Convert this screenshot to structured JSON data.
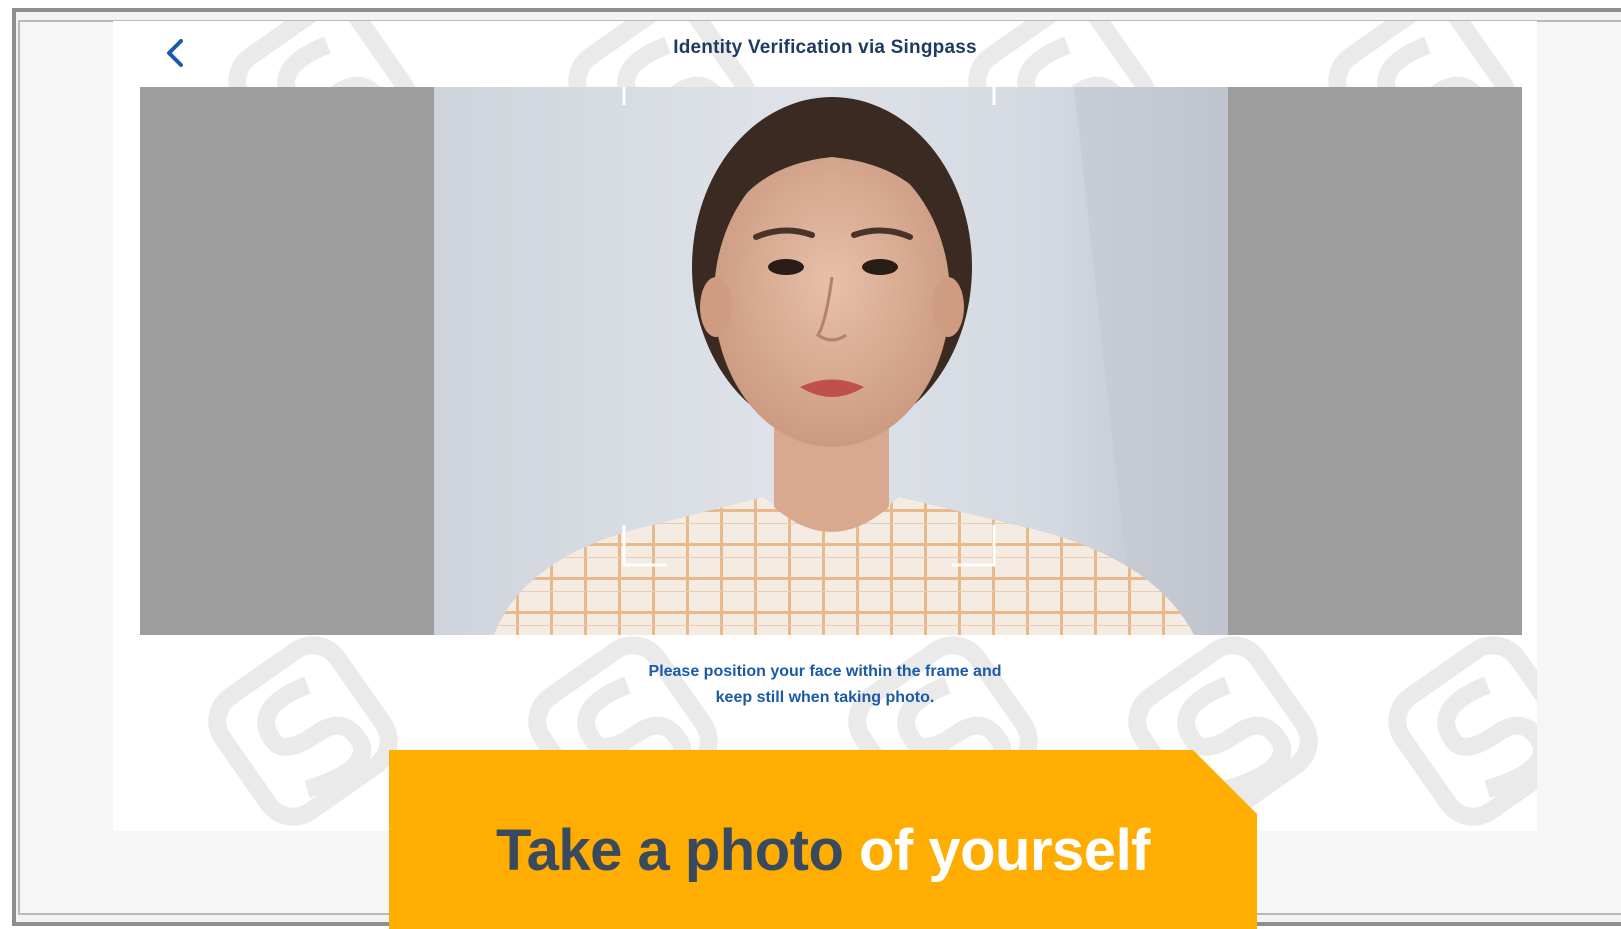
{
  "header": {
    "title": "Identity Verification via Singpass",
    "back_icon": "chevron-left-icon"
  },
  "camera": {
    "instruction_line1": "Please position your face within the frame and",
    "instruction_line2": "keep still when taking photo."
  },
  "caption": {
    "part_dark": "Take a photo",
    "part_light": "of yourself"
  },
  "colors": {
    "accent_blue": "#1a5aa8",
    "banner_orange": "#FFAD00",
    "caption_dark": "#3a4a5e",
    "side_gray": "#9d9d9d"
  }
}
